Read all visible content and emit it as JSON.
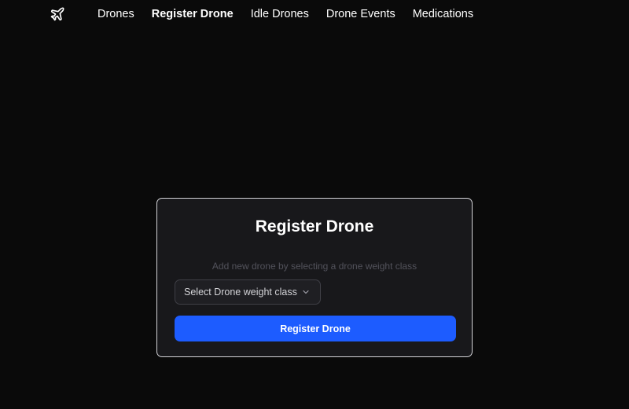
{
  "nav": {
    "logo_icon": "airplane-icon",
    "items": [
      {
        "label": "Drones",
        "active": false
      },
      {
        "label": "Register Drone",
        "active": true
      },
      {
        "label": "Idle Drones",
        "active": false
      },
      {
        "label": "Drone Events",
        "active": false
      },
      {
        "label": "Medications",
        "active": false
      }
    ]
  },
  "card": {
    "title": "Register Drone",
    "subtitle": "Add new drone by selecting a drone weight class",
    "select": {
      "placeholder": "Select Drone weight class",
      "icon": "chevron-down-icon"
    },
    "submit_label": "Register Drone"
  },
  "colors": {
    "background": "#0a0a0a",
    "card_background": "#18181b",
    "card_border": "#d4d4d8",
    "accent": "#1d5cff",
    "subtitle": "#52525b"
  }
}
